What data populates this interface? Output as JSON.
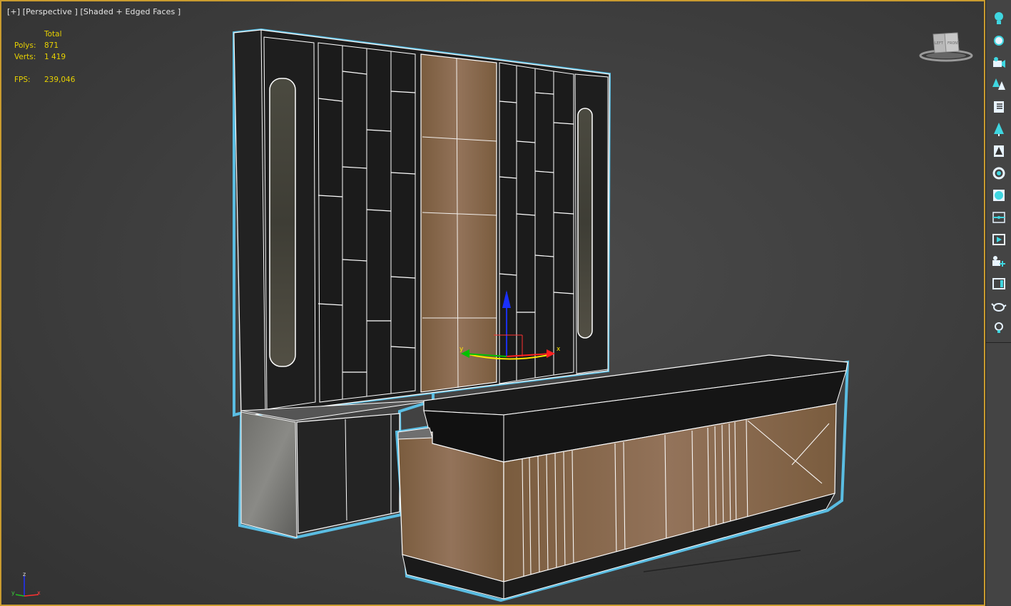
{
  "viewport": {
    "label_plus": "[+]",
    "label_view": "[Perspective ]",
    "label_shading": "[Shaded + Edged Faces ]"
  },
  "stats": {
    "header": "Total",
    "polys_label": "Polys:",
    "polys_value": "871",
    "verts_label": "Verts:",
    "verts_value": "1 419",
    "fps_label": "FPS:",
    "fps_value": "239,046"
  },
  "viewcube": {
    "left_face": "LEFT",
    "front_face": "FRONT"
  },
  "axis_tripod": {
    "x": "x",
    "y": "y",
    "z": "z"
  },
  "gizmo": {
    "x": "x",
    "y": "y"
  },
  "toolbar_icons": [
    "light-bulb-icon",
    "sun-icon",
    "camera-icon",
    "trees-icon",
    "document-icon",
    "tree-icon",
    "tree-card-icon",
    "rotate-icon",
    "material-sphere-icon",
    "viewport-target-icon",
    "render-frame-icon",
    "camera-add-icon",
    "layout-icon",
    "teapot-icon",
    "bulb-small-icon"
  ],
  "colors": {
    "viewport_border": "#c99b2f",
    "stats_text": "#e8d200",
    "selection_outline": "#5fd3ff",
    "wood": "#8a6a4a"
  }
}
